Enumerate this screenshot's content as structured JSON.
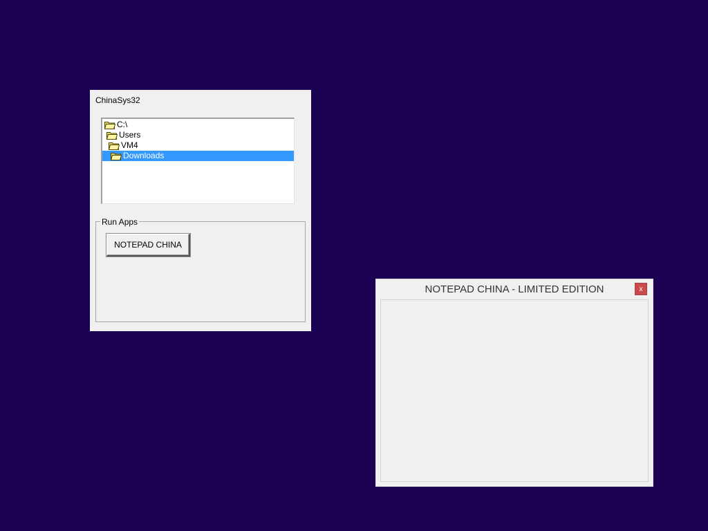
{
  "desktop": {
    "background": "#1a0052"
  },
  "sys_window": {
    "title": "ChinaSys32",
    "tree": {
      "items": [
        {
          "label": "C:\\",
          "icon": "folder-open-icon",
          "selected": false
        },
        {
          "label": "Users",
          "icon": "folder-open-icon",
          "selected": false
        },
        {
          "label": "VM4",
          "icon": "folder-open-icon",
          "selected": false
        },
        {
          "label": "Downloads",
          "icon": "folder-open-icon",
          "selected": true
        }
      ]
    },
    "group": {
      "label": "Run Apps",
      "button_label": "NOTEPAD CHINA"
    }
  },
  "notepad_window": {
    "title": "NOTEPAD CHINA - LIMITED EDITION",
    "close_label": "x",
    "text_value": ""
  }
}
